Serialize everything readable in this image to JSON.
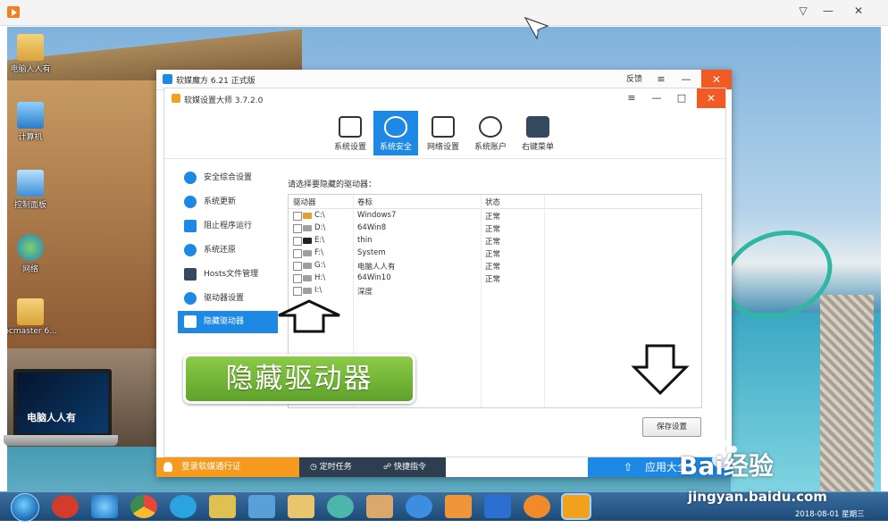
{
  "player": {
    "controls": [
      "▽",
      "—",
      "✕"
    ]
  },
  "desktop": {
    "icons": [
      {
        "label": "电脑人人有"
      },
      {
        "label": "计算机"
      },
      {
        "label": "控制面板"
      },
      {
        "label": "网络"
      },
      {
        "label": "pcmaster 6..."
      }
    ],
    "laptop_text": "电脑人人有"
  },
  "outer_window": {
    "title": "软媒魔方 6.21 正式版",
    "feedback": "反馈",
    "menu": "≡",
    "minimize": "—",
    "close": "✕"
  },
  "inner_window": {
    "title": "软媒设置大师 3.7.2.0",
    "menu": "≡",
    "minimize": "—",
    "maximize": "□",
    "close": "✕"
  },
  "toolbar": {
    "tabs": [
      {
        "label": "系统设置"
      },
      {
        "label": "系统安全"
      },
      {
        "label": "网络设置"
      },
      {
        "label": "系统账户"
      },
      {
        "label": "右键菜单"
      }
    ]
  },
  "sidebar": {
    "items": [
      {
        "label": "安全综合设置"
      },
      {
        "label": "系统更新"
      },
      {
        "label": "阻止程序运行"
      },
      {
        "label": "系统还原"
      },
      {
        "label": "Hosts文件管理"
      },
      {
        "label": "驱动器设置"
      },
      {
        "label": "隐藏驱动器"
      }
    ]
  },
  "main": {
    "prompt": "请选择要隐藏的驱动器：",
    "columns": [
      "驱动器",
      "卷标",
      "状态"
    ],
    "rows": [
      {
        "drive": "C:\\",
        "label": "Windows7",
        "status": "正常"
      },
      {
        "drive": "D:\\",
        "label": "64Win8",
        "status": "正常"
      },
      {
        "drive": "E:\\",
        "label": "thin",
        "status": "正常"
      },
      {
        "drive": "F:\\",
        "label": "System",
        "status": "正常"
      },
      {
        "drive": "G:\\",
        "label": "电脑人人有",
        "status": "正常"
      },
      {
        "drive": "H:\\",
        "label": "64Win10",
        "status": "正常"
      },
      {
        "drive": "I:\\",
        "label": "深度",
        "status": ""
      }
    ],
    "save_button": "保存设置"
  },
  "bottom_bar": {
    "login": "登录软媒通行证",
    "scheduled": "定时任务",
    "shortcut": "快捷指令",
    "apps": "应用大全"
  },
  "annotation": {
    "callout": "隐藏驱动器"
  },
  "taskbar": {
    "date": "2018-08-01 星期三"
  },
  "watermark": {
    "brand": "Bai经验",
    "url": "jingyan.baidu.com"
  },
  "colors": {
    "accent": "#1e88e5",
    "close": "#f25a23",
    "login": "#f59a1e",
    "callout": "#6db634"
  }
}
